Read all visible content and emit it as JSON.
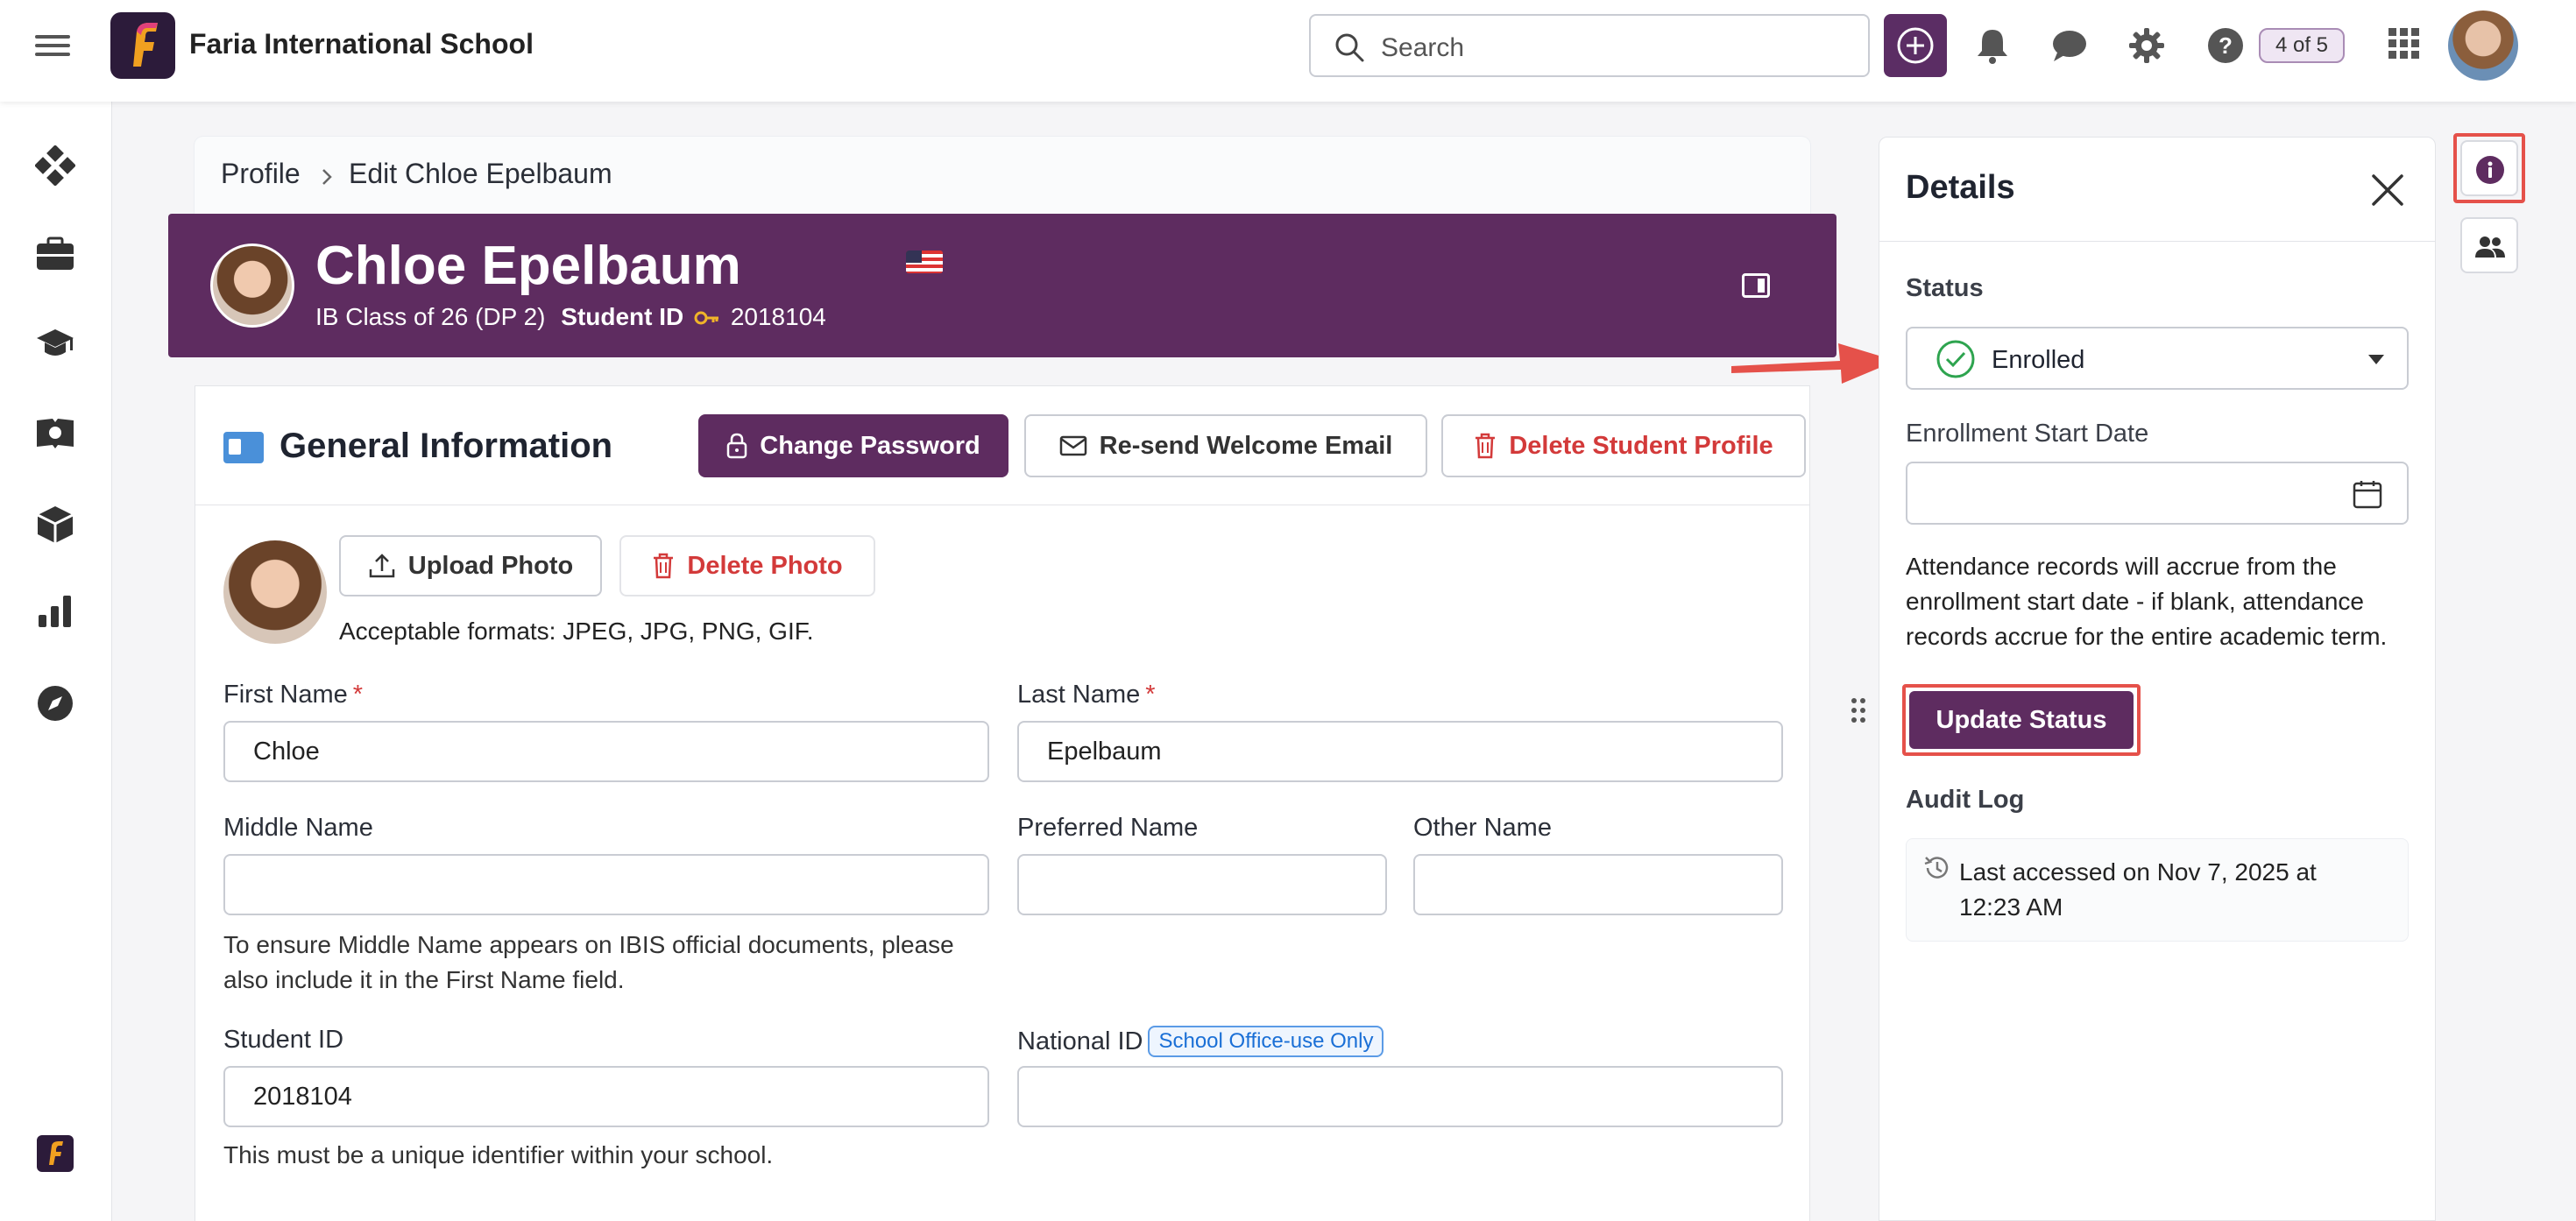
{
  "app": {
    "school_name": "Faria International School",
    "search_placeholder": "Search",
    "notification_count": "4 of 5",
    "brand_color": "#5e2c60",
    "highlight_color": "#e5514a"
  },
  "breadcrumb": {
    "root": "Profile",
    "current": "Edit Chloe Epelbaum"
  },
  "student": {
    "name": "Chloe Epelbaum",
    "class": "IB Class of 26 (DP 2)",
    "student_id_label": "Student ID",
    "student_id": "2018104"
  },
  "general": {
    "title": "General Information",
    "change_password": "Change Password",
    "resend_email": "Re-send Welcome Email",
    "delete_profile": "Delete Student Profile",
    "upload_photo": "Upload Photo",
    "delete_photo": "Delete Photo",
    "formats_hint": "Acceptable formats: JPEG, JPG, PNG, GIF."
  },
  "form": {
    "first_name_label": "First Name",
    "first_name_value": "Chloe",
    "last_name_label": "Last Name",
    "last_name_value": "Epelbaum",
    "required_mark": "*",
    "middle_name_label": "Middle Name",
    "middle_name_value": "",
    "middle_name_hint": "To ensure Middle Name appears on IBIS official documents, please also include it in the First Name field.",
    "preferred_name_label": "Preferred Name",
    "preferred_name_value": "",
    "other_name_label": "Other Name",
    "other_name_value": "",
    "student_id_label": "Student ID",
    "student_id_value": "2018104",
    "student_id_hint": "This must be a unique identifier within your school.",
    "national_id_label": "National ID",
    "national_id_tag": "School Office-use Only",
    "national_id_value": ""
  },
  "details": {
    "title": "Details",
    "status_label": "Status",
    "status_value": "Enrolled",
    "enrollment_label": "Enrollment Start Date",
    "enrollment_value": "",
    "attendance_text": "Attendance records will accrue from the enrollment start date - if blank, attendance records accrue for the entire academic term.",
    "update_button": "Update Status",
    "audit_label": "Audit Log",
    "audit_text": "Last accessed on Nov 7, 2025 at 12:23 AM"
  },
  "icons": {
    "menu": "hamburger-icon",
    "search": "search-icon",
    "add": "plus-icon",
    "notifications": "bell-icon",
    "messages": "chat-icon",
    "settings": "gear-icon",
    "help": "help-icon",
    "apps": "grid-icon",
    "info": "info-icon",
    "people": "people-icon"
  }
}
